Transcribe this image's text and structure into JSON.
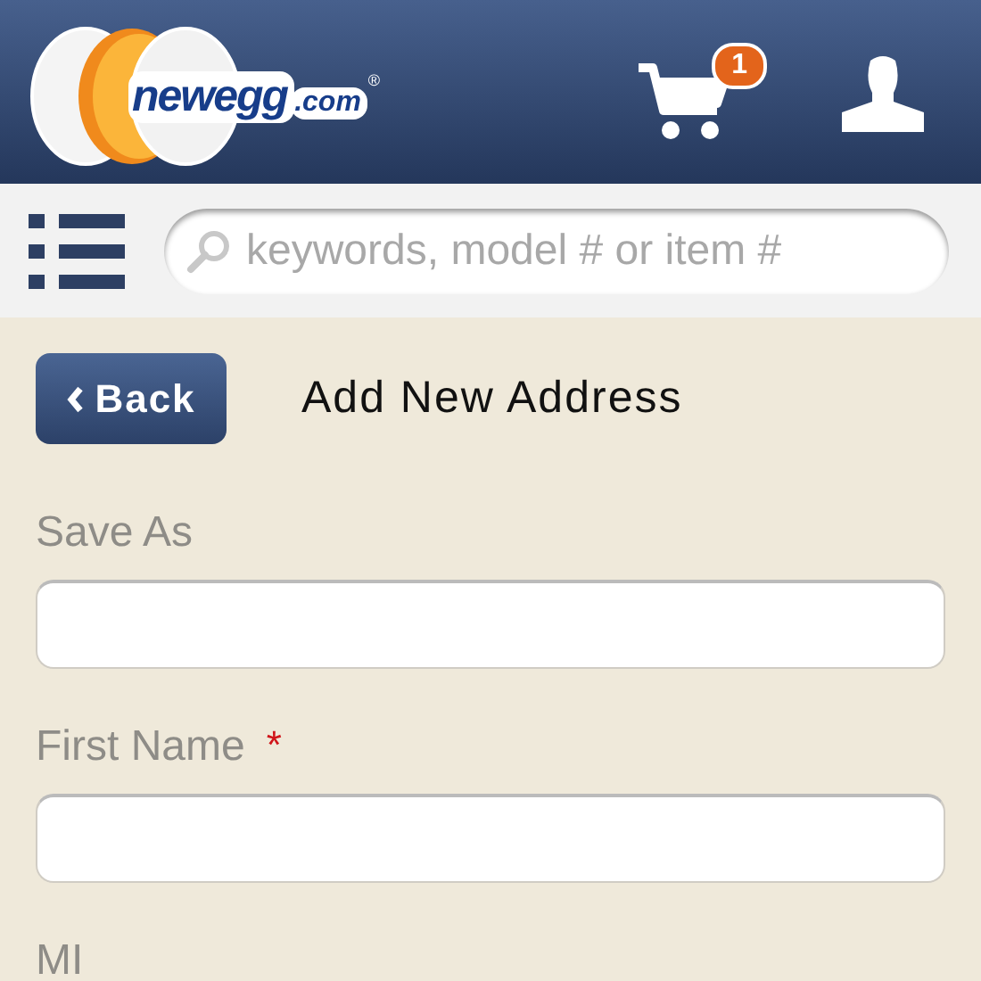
{
  "header": {
    "logo": {
      "name": "newegg",
      "domain": ".com",
      "registered": "®"
    },
    "cart": {
      "count": "1"
    }
  },
  "search": {
    "placeholder": "keywords, model # or item #"
  },
  "page": {
    "back_button": "Back",
    "title": "Add New Address"
  },
  "fields": [
    {
      "label": "Save As",
      "kind": "text"
    },
    {
      "label": "First Name",
      "required_mark": "*",
      "kind": "text"
    },
    {
      "label": "MI",
      "kind": "label"
    }
  ]
}
